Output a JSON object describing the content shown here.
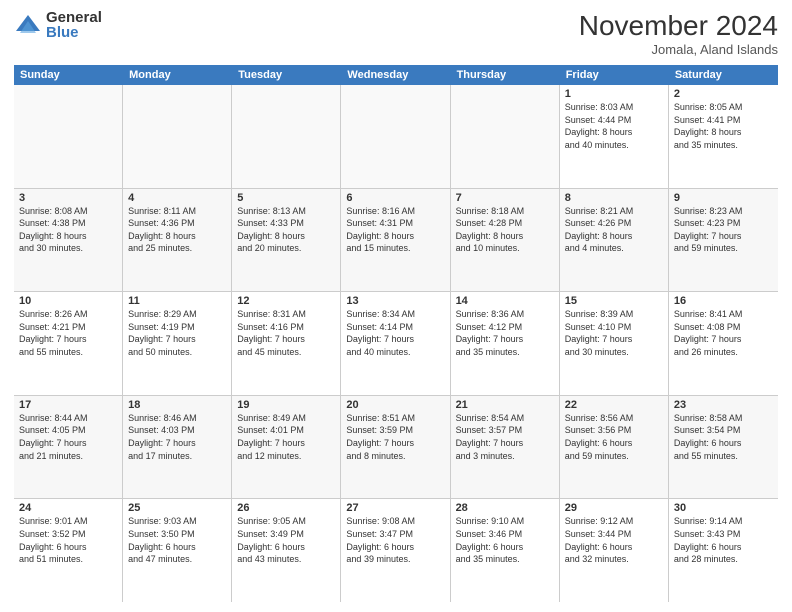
{
  "logo": {
    "general": "General",
    "blue": "Blue"
  },
  "header": {
    "title": "November 2024",
    "subtitle": "Jomala, Aland Islands"
  },
  "weekdays": [
    "Sunday",
    "Monday",
    "Tuesday",
    "Wednesday",
    "Thursday",
    "Friday",
    "Saturday"
  ],
  "weeks": [
    [
      {
        "day": "",
        "info": ""
      },
      {
        "day": "",
        "info": ""
      },
      {
        "day": "",
        "info": ""
      },
      {
        "day": "",
        "info": ""
      },
      {
        "day": "",
        "info": ""
      },
      {
        "day": "1",
        "info": "Sunrise: 8:03 AM\nSunset: 4:44 PM\nDaylight: 8 hours\nand 40 minutes."
      },
      {
        "day": "2",
        "info": "Sunrise: 8:05 AM\nSunset: 4:41 PM\nDaylight: 8 hours\nand 35 minutes."
      }
    ],
    [
      {
        "day": "3",
        "info": "Sunrise: 8:08 AM\nSunset: 4:38 PM\nDaylight: 8 hours\nand 30 minutes."
      },
      {
        "day": "4",
        "info": "Sunrise: 8:11 AM\nSunset: 4:36 PM\nDaylight: 8 hours\nand 25 minutes."
      },
      {
        "day": "5",
        "info": "Sunrise: 8:13 AM\nSunset: 4:33 PM\nDaylight: 8 hours\nand 20 minutes."
      },
      {
        "day": "6",
        "info": "Sunrise: 8:16 AM\nSunset: 4:31 PM\nDaylight: 8 hours\nand 15 minutes."
      },
      {
        "day": "7",
        "info": "Sunrise: 8:18 AM\nSunset: 4:28 PM\nDaylight: 8 hours\nand 10 minutes."
      },
      {
        "day": "8",
        "info": "Sunrise: 8:21 AM\nSunset: 4:26 PM\nDaylight: 8 hours\nand 4 minutes."
      },
      {
        "day": "9",
        "info": "Sunrise: 8:23 AM\nSunset: 4:23 PM\nDaylight: 7 hours\nand 59 minutes."
      }
    ],
    [
      {
        "day": "10",
        "info": "Sunrise: 8:26 AM\nSunset: 4:21 PM\nDaylight: 7 hours\nand 55 minutes."
      },
      {
        "day": "11",
        "info": "Sunrise: 8:29 AM\nSunset: 4:19 PM\nDaylight: 7 hours\nand 50 minutes."
      },
      {
        "day": "12",
        "info": "Sunrise: 8:31 AM\nSunset: 4:16 PM\nDaylight: 7 hours\nand 45 minutes."
      },
      {
        "day": "13",
        "info": "Sunrise: 8:34 AM\nSunset: 4:14 PM\nDaylight: 7 hours\nand 40 minutes."
      },
      {
        "day": "14",
        "info": "Sunrise: 8:36 AM\nSunset: 4:12 PM\nDaylight: 7 hours\nand 35 minutes."
      },
      {
        "day": "15",
        "info": "Sunrise: 8:39 AM\nSunset: 4:10 PM\nDaylight: 7 hours\nand 30 minutes."
      },
      {
        "day": "16",
        "info": "Sunrise: 8:41 AM\nSunset: 4:08 PM\nDaylight: 7 hours\nand 26 minutes."
      }
    ],
    [
      {
        "day": "17",
        "info": "Sunrise: 8:44 AM\nSunset: 4:05 PM\nDaylight: 7 hours\nand 21 minutes."
      },
      {
        "day": "18",
        "info": "Sunrise: 8:46 AM\nSunset: 4:03 PM\nDaylight: 7 hours\nand 17 minutes."
      },
      {
        "day": "19",
        "info": "Sunrise: 8:49 AM\nSunset: 4:01 PM\nDaylight: 7 hours\nand 12 minutes."
      },
      {
        "day": "20",
        "info": "Sunrise: 8:51 AM\nSunset: 3:59 PM\nDaylight: 7 hours\nand 8 minutes."
      },
      {
        "day": "21",
        "info": "Sunrise: 8:54 AM\nSunset: 3:57 PM\nDaylight: 7 hours\nand 3 minutes."
      },
      {
        "day": "22",
        "info": "Sunrise: 8:56 AM\nSunset: 3:56 PM\nDaylight: 6 hours\nand 59 minutes."
      },
      {
        "day": "23",
        "info": "Sunrise: 8:58 AM\nSunset: 3:54 PM\nDaylight: 6 hours\nand 55 minutes."
      }
    ],
    [
      {
        "day": "24",
        "info": "Sunrise: 9:01 AM\nSunset: 3:52 PM\nDaylight: 6 hours\nand 51 minutes."
      },
      {
        "day": "25",
        "info": "Sunrise: 9:03 AM\nSunset: 3:50 PM\nDaylight: 6 hours\nand 47 minutes."
      },
      {
        "day": "26",
        "info": "Sunrise: 9:05 AM\nSunset: 3:49 PM\nDaylight: 6 hours\nand 43 minutes."
      },
      {
        "day": "27",
        "info": "Sunrise: 9:08 AM\nSunset: 3:47 PM\nDaylight: 6 hours\nand 39 minutes."
      },
      {
        "day": "28",
        "info": "Sunrise: 9:10 AM\nSunset: 3:46 PM\nDaylight: 6 hours\nand 35 minutes."
      },
      {
        "day": "29",
        "info": "Sunrise: 9:12 AM\nSunset: 3:44 PM\nDaylight: 6 hours\nand 32 minutes."
      },
      {
        "day": "30",
        "info": "Sunrise: 9:14 AM\nSunset: 3:43 PM\nDaylight: 6 hours\nand 28 minutes."
      }
    ]
  ]
}
